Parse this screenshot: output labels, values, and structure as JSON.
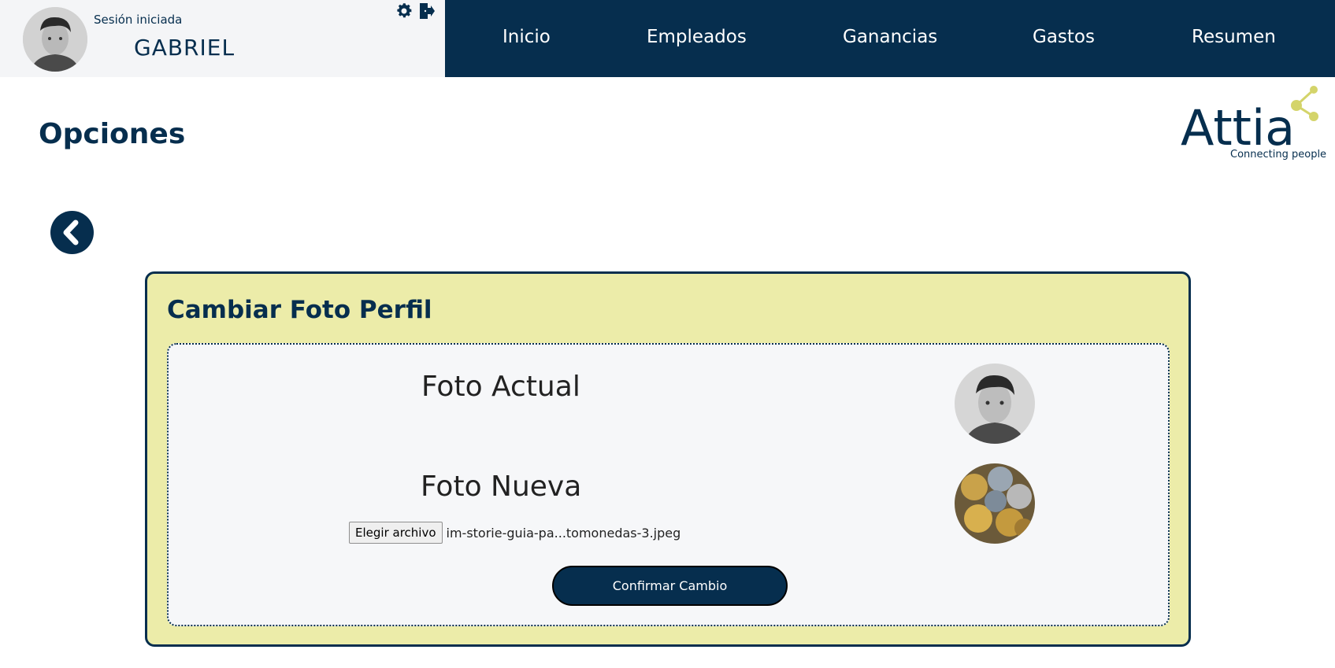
{
  "header": {
    "session_label": "Sesión iniciada",
    "user_name": "GABRIEL",
    "icons": [
      "gear-icon",
      "logout-icon"
    ]
  },
  "nav": {
    "items": [
      {
        "label": "Inicio"
      },
      {
        "label": "Empleados"
      },
      {
        "label": "Ganancias"
      },
      {
        "label": "Gastos"
      },
      {
        "label": "Resumen"
      }
    ]
  },
  "page": {
    "title": "Opciones"
  },
  "logo": {
    "name": "Attia",
    "tagline": "Connecting people"
  },
  "card": {
    "title": "Cambiar Foto Perfil",
    "current_photo_label": "Foto Actual",
    "new_photo_label": "Foto Nueva",
    "file_button_label": "Elegir archivo",
    "file_name": "im-storie-guia-pa...tomonedas-3.jpeg",
    "confirm_label": "Confirmar Cambio"
  },
  "colors": {
    "navy": "#062e4e",
    "card_bg": "#ececa9",
    "logo_accent": "#d4d46a"
  }
}
